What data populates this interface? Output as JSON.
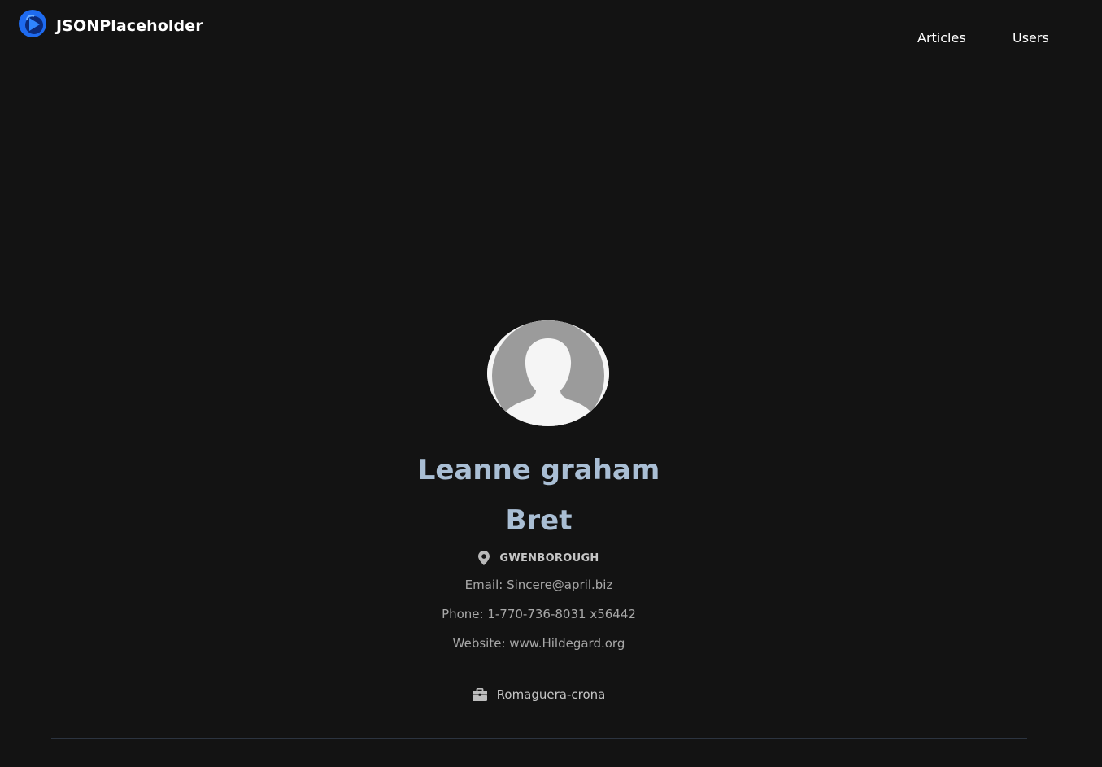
{
  "navbar": {
    "brand": "JSONPlaceholder",
    "links": [
      {
        "label": "Articles"
      },
      {
        "label": "Users"
      }
    ]
  },
  "profile": {
    "name": "Leanne graham",
    "username": "Bret",
    "city": "Gwenborough",
    "email_line": "Email: Sincere@april.biz",
    "phone_line": "Phone: 1-770-736-8031 x56442",
    "website_line": "Website: www.Hildegard.org",
    "company": "Romaguera-crona"
  },
  "icons": {
    "brand": "logo-icon",
    "avatar": "user-silhouette-icon",
    "city": "map-pin-icon",
    "company": "briefcase-icon"
  },
  "colors": {
    "background": "#131313",
    "accent_blue": "#1e6bf0",
    "name_text": "#a9bed4",
    "muted_text": "#a8a8a8"
  }
}
